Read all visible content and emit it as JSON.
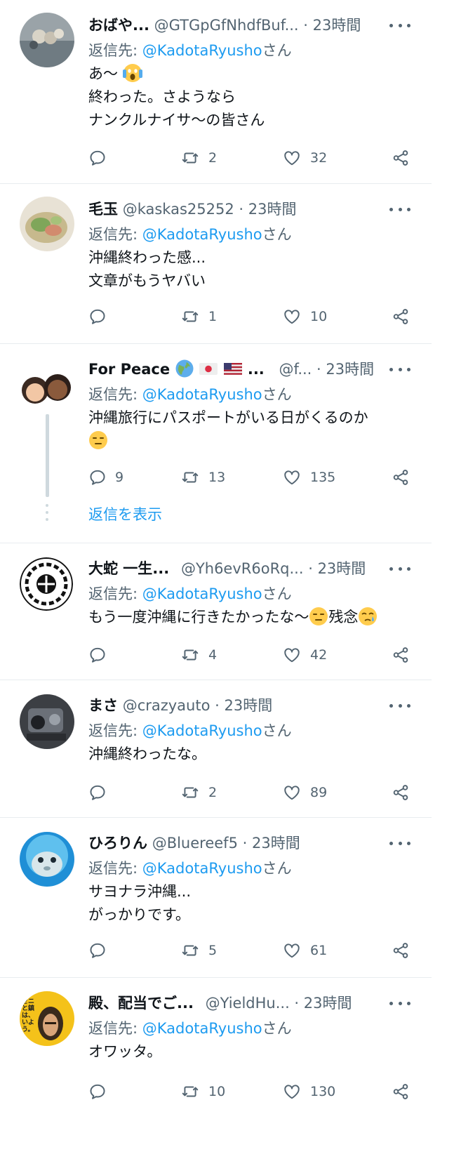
{
  "tweets": [
    {
      "name": "おばや...",
      "handle": "@GTGpGfNhdfBuf...",
      "time": "23時間",
      "reply_prefix": "返信先: ",
      "reply_mention": "@KadotaRyusho",
      "reply_suffix": "さん",
      "lines": [
        "あ〜",
        "終わった。さようなら",
        "ナンクルナイサ〜の皆さん"
      ],
      "emojis": [
        "scream"
      ],
      "counts": {
        "reply": "",
        "retweet": "2",
        "like": "32"
      }
    },
    {
      "name": "毛玉",
      "handle": "@kaskas25252",
      "time": "23時間",
      "reply_prefix": "返信先: ",
      "reply_mention": "@KadotaRyusho",
      "reply_suffix": "さん",
      "lines": [
        "沖縄終わった感...",
        "文章がもうヤバい"
      ],
      "counts": {
        "reply": "",
        "retweet": "1",
        "like": "10"
      }
    },
    {
      "name": "For Peace",
      "name_emojis": [
        "globe",
        "japan-flag",
        "us-flag"
      ],
      "name_ellipsis": "...",
      "handle": "@f...",
      "time": "23時間",
      "reply_prefix": "返信先: ",
      "reply_mention": "@KadotaRyusho",
      "reply_suffix": "さん",
      "lines": [
        "沖縄旅行にパスポートがいる日がくるのか"
      ],
      "emojis": [
        "expressionless"
      ],
      "counts": {
        "reply": "9",
        "retweet": "13",
        "like": "135"
      },
      "show_replies": "返信を表示"
    },
    {
      "name": "大蛇 一生...",
      "handle": "@Yh6evR6oRq...",
      "time": "23時間",
      "reply_prefix": "返信先: ",
      "reply_mention": "@KadotaRyusho",
      "reply_suffix": "さん",
      "lines": [
        "もう一度沖縄に行きたかったな〜",
        "残念"
      ],
      "emojis": [
        "expressionless",
        "crying"
      ],
      "counts": {
        "reply": "",
        "retweet": "4",
        "like": "42"
      }
    },
    {
      "name": "まさ",
      "handle": "@crazyauto",
      "time": "23時間",
      "reply_prefix": "返信先: ",
      "reply_mention": "@KadotaRyusho",
      "reply_suffix": "さん",
      "lines": [
        "沖縄終わったな。"
      ],
      "counts": {
        "reply": "",
        "retweet": "2",
        "like": "89"
      }
    },
    {
      "name": "ひろりん",
      "handle": "@Bluereef5",
      "time": "23時間",
      "reply_prefix": "返信先: ",
      "reply_mention": "@KadotaRyusho",
      "reply_suffix": "さん",
      "lines": [
        "サヨナラ沖縄...",
        "がっかりです。"
      ],
      "counts": {
        "reply": "",
        "retweet": "5",
        "like": "61"
      }
    },
    {
      "name": "殿、配当でご...",
      "handle": "@YieldHu...",
      "time": "23時間",
      "reply_prefix": "返信先: ",
      "reply_mention": "@KadotaRyusho",
      "reply_suffix": "さん",
      "lines": [
        "オワッタ。"
      ],
      "avatar_text": "ゼニと鎮は、いよう。",
      "counts": {
        "reply": "",
        "retweet": "10",
        "like": "130"
      }
    }
  ],
  "separator": " · ",
  "colors": {
    "accent": "#1d9bf0",
    "secondary": "#536471",
    "divider": "#e8ecef"
  },
  "icons": {
    "reply": "reply-icon",
    "retweet": "retweet-icon",
    "like": "heart-icon",
    "share": "share-icon",
    "more": "more-icon"
  }
}
